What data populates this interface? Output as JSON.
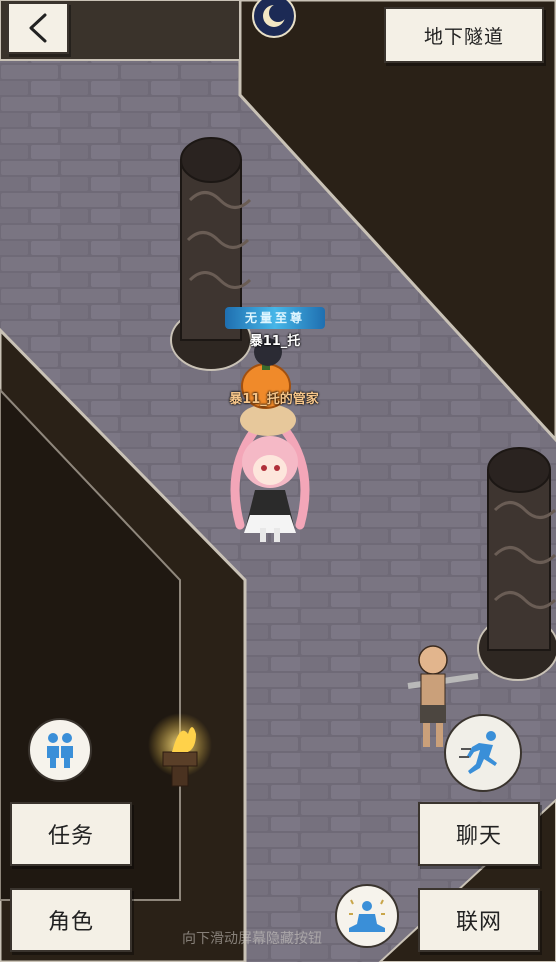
{
  "location": "地下隧道",
  "player": {
    "title": "无量至尊",
    "name": "暴11_托"
  },
  "pet": {
    "name": "暴11_托的管家"
  },
  "buttons": {
    "quest": "任务",
    "character": "角色",
    "chat": "聊天",
    "network": "联网"
  },
  "icons": {
    "back": "chevron-left-icon",
    "time": "moon-clock-icon",
    "team": "two-people-icon",
    "run": "running-figure-icon",
    "meditate": "meditating-figure-icon"
  },
  "hint": "向下滑动屏幕隐藏按钮",
  "colors": {
    "button_bg": "#f4f0e6",
    "floor": "#6e6976",
    "wall_dark": "#2a2117",
    "title_cyan": "#9fe6ff",
    "pet_name": "#f5c58a"
  }
}
